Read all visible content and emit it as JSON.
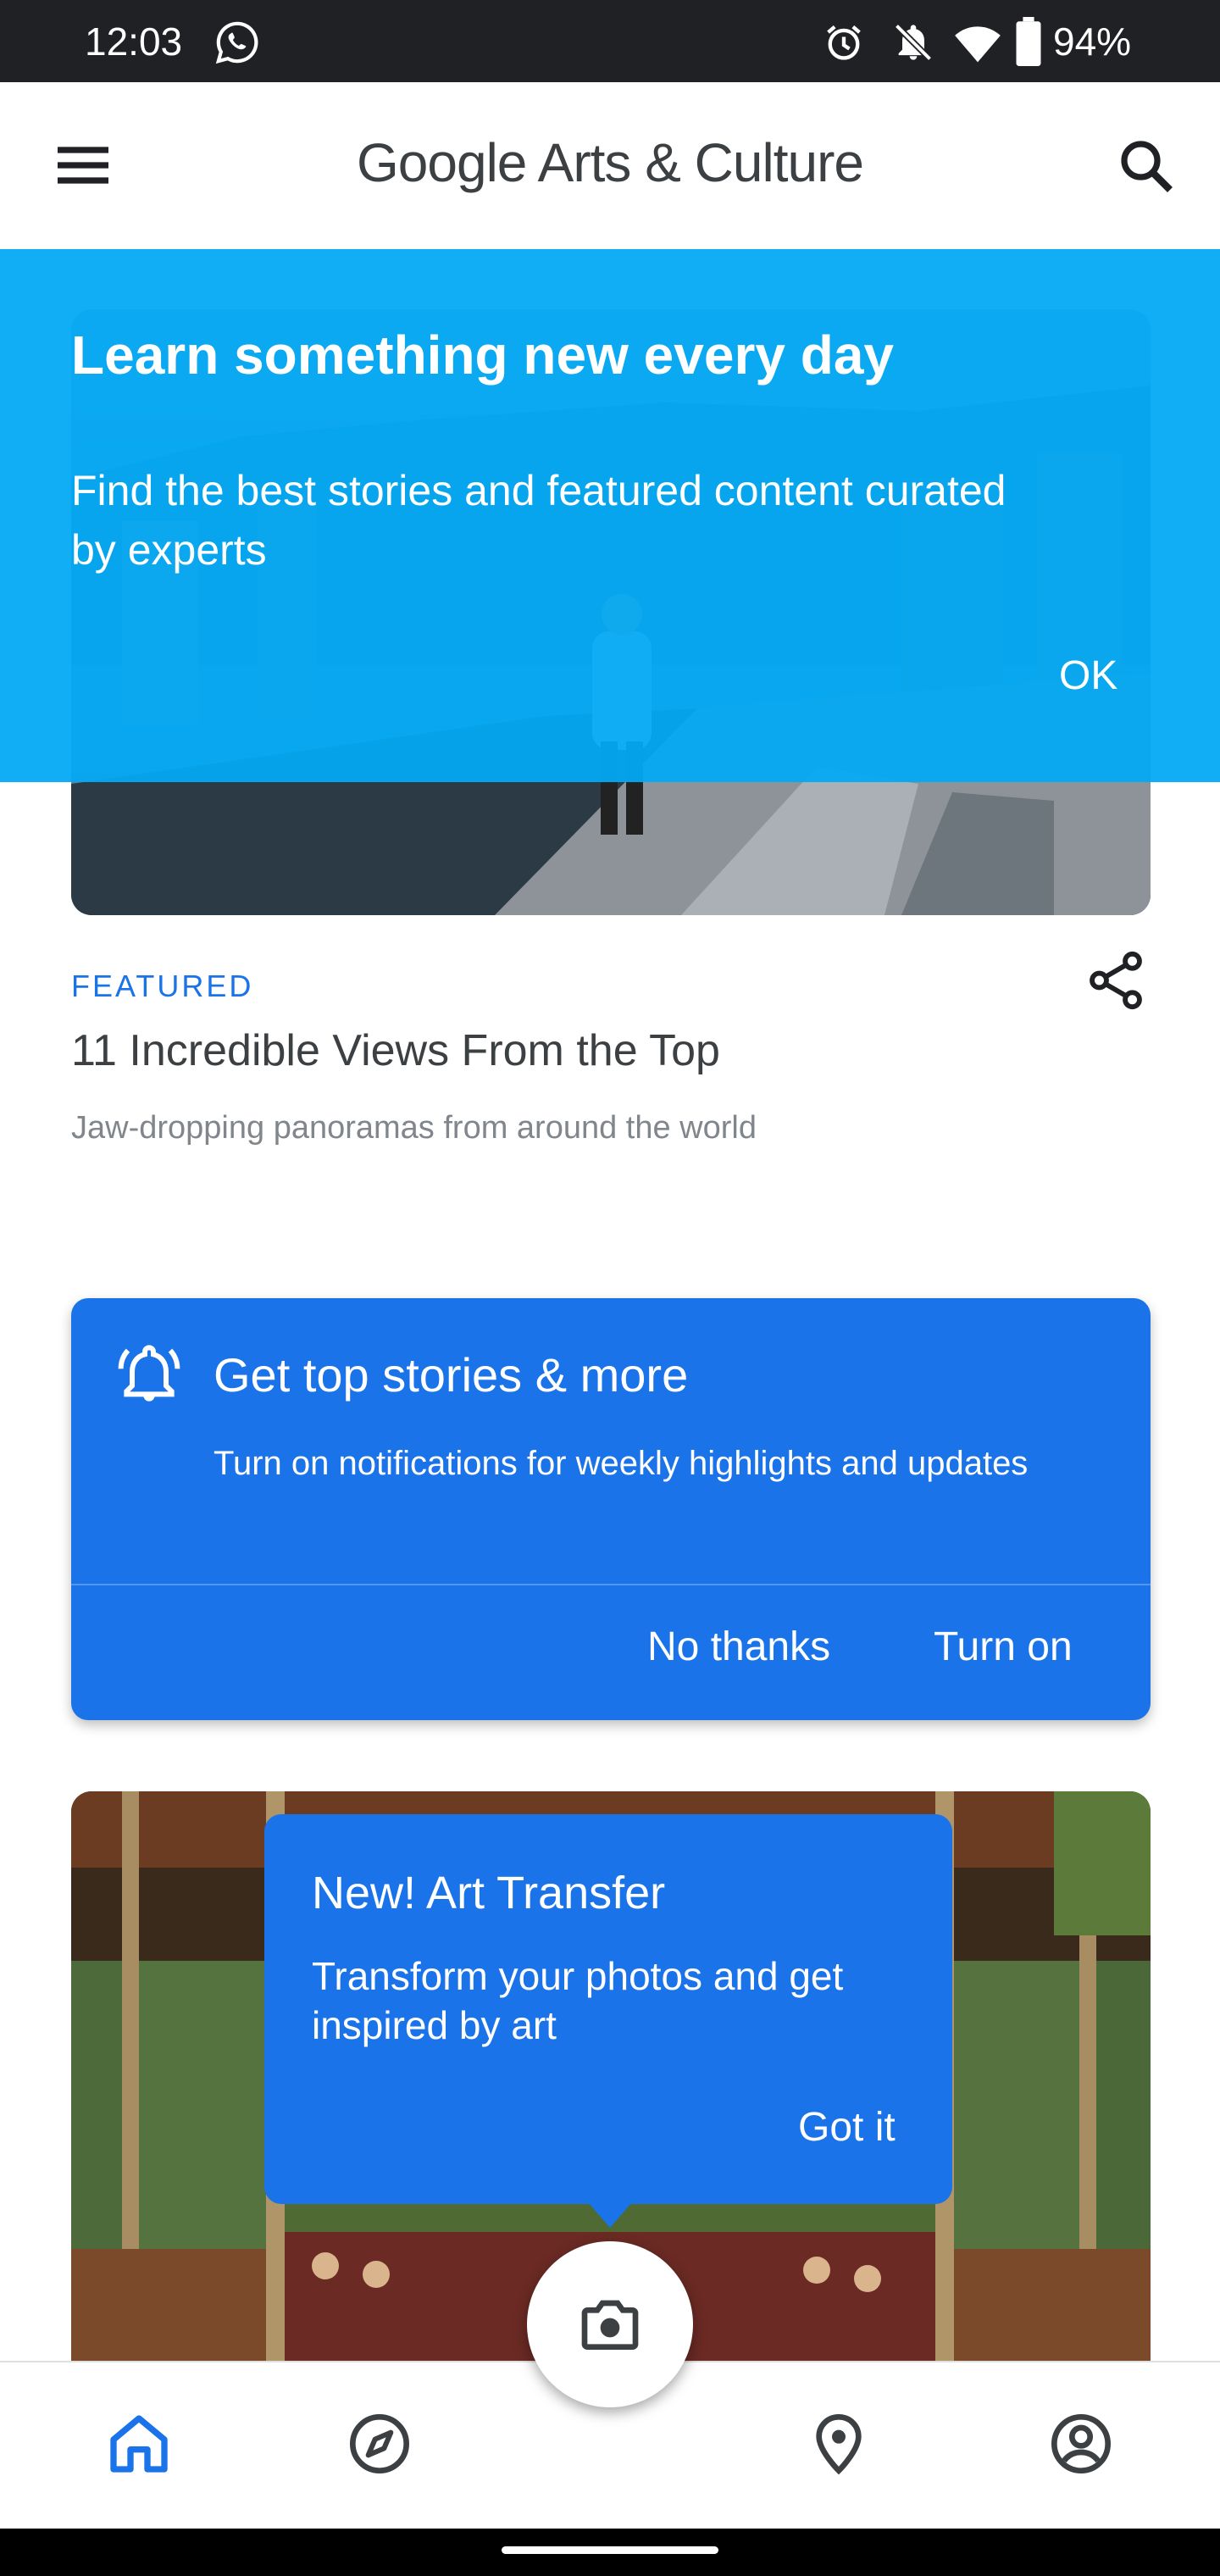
{
  "status_bar": {
    "time": "12:03",
    "battery_percent": "94%",
    "icons": [
      "whatsapp-icon",
      "alarm-icon",
      "notifications-off-icon",
      "wifi-icon",
      "battery-icon"
    ]
  },
  "app_bar": {
    "logo_google": "Google",
    "logo_rest": " Arts & Culture",
    "icons": [
      "menu-icon",
      "search-icon"
    ]
  },
  "onboarding": {
    "title": "Learn something new every day",
    "text": "Find the best stories and featured content curated by experts",
    "ok_label": "OK",
    "bg_color": "#03a9f4"
  },
  "featured": {
    "tag": "FEATURED",
    "title": "11 Incredible Views From the Top",
    "subtitle": "Jaw-dropping panoramas from around the world",
    "tag_color": "#1a73e8"
  },
  "notification_card": {
    "title": "Get top stories & more",
    "text": "Turn on notifications for weekly highlights and updates",
    "no_label": "No thanks",
    "on_label": "Turn on",
    "bg_color": "#1a73e8"
  },
  "art_transfer_tip": {
    "title": "New! Art Transfer",
    "text": "Transform your photos and get inspired by art",
    "got_it_label": "Got it"
  },
  "bottom_nav": {
    "items": [
      "home-icon",
      "explore-icon",
      "camera-icon",
      "nearby-icon",
      "profile-icon"
    ],
    "active": "home-icon",
    "active_color": "#1a73e8"
  }
}
